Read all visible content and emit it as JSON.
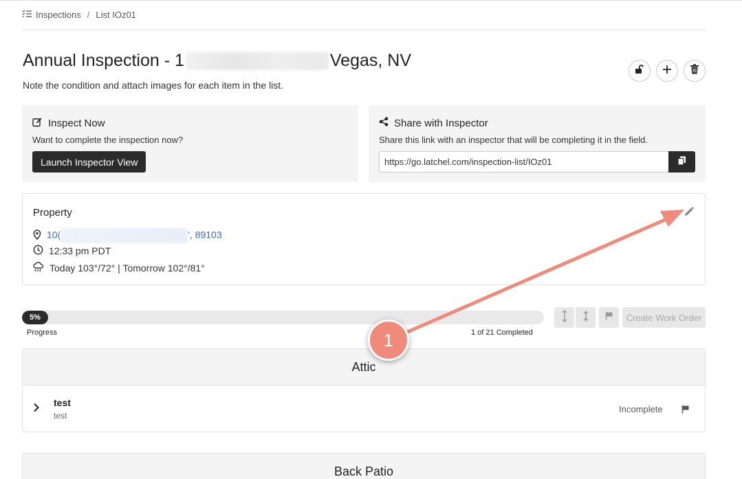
{
  "breadcrumb": {
    "root": "Inspections",
    "separator": "/",
    "current": "List IOz01"
  },
  "page": {
    "title_start": "Annual Inspection - 1",
    "title_end": "Vegas, NV",
    "subtitle": "Note the condition and attach images for each item in the list."
  },
  "actions": {
    "icons": [
      "unlock-icon",
      "plus-icon",
      "trash-icon"
    ]
  },
  "inspect_now": {
    "title": "Inspect Now",
    "text": "Want to complete the inspection now?",
    "button": "Launch Inspector View"
  },
  "share": {
    "title": "Share with Inspector",
    "text": "Share this link with an inspector that will be completing it in the field.",
    "link": "https://go.latchel.com/inspection-list/IOz01"
  },
  "property": {
    "title": "Property",
    "address_start": "10(",
    "address_end": "', 89103",
    "time": "12:33 pm PDT",
    "weather": "Today 103°/72° | Tomorrow 102°/81°"
  },
  "progress": {
    "percent_label": "5%",
    "percent": 5,
    "label": "Progress",
    "completed": "1 of 21 Completed",
    "create_work_order": "Create Work Order"
  },
  "sections": [
    {
      "name": "Attic",
      "items": [
        {
          "title": "test",
          "subtitle": "test",
          "status": "Incomplete"
        }
      ]
    },
    {
      "name": "Back Patio",
      "items": []
    }
  ],
  "annotation": {
    "number": "1"
  },
  "colors": {
    "accent": "#2b2b2b",
    "link": "#2f6cbe",
    "annotation": "#f08a7a"
  }
}
